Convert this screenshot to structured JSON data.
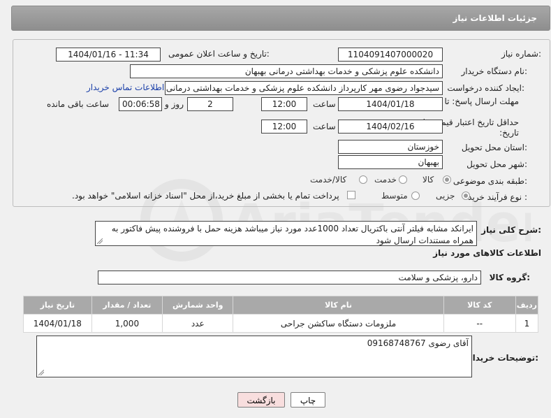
{
  "header": {
    "title": "جزئیات اطلاعات نیاز"
  },
  "form": {
    "need_number_label": "شماره نیاز:",
    "need_number": "1104091407000020",
    "announce_label": "تاریخ و ساعت اعلان عمومی:",
    "announce_value": "1404/01/16 - 11:34",
    "buyer_org_label": "نام دستگاه خریدار:",
    "buyer_org": "دانشکده علوم پزشکی و خدمات بهداشتی  درمانی بهبهان",
    "creator_label": "ایجاد کننده درخواست:",
    "creator": "سیدجواد رضوی مهر کارپرداز دانشکده علوم پزشکی و خدمات بهداشتی  درمانی",
    "buyer_contact_link": "اطلاعات تماس خریدار",
    "reply_deadline_label": "مهلت ارسال پاسخ: تا تاریخ:",
    "reply_date": "1404/01/18",
    "time_label": "ساعت",
    "reply_time": "12:00",
    "days": "2",
    "days_label": "روز و",
    "remaining_time": "00:06:58",
    "remaining_label": "ساعت باقی مانده",
    "price_validity_label": "حداقل تاریخ اعتبار قیمت: تا تاریخ:",
    "validity_date": "1404/02/16",
    "validity_time": "12:00",
    "province_label": "استان محل تحویل:",
    "province": "خوزستان",
    "city_label": "شهر محل تحویل:",
    "city": "بهبهان",
    "category_label": "طبقه بندی موضوعی:",
    "category_options": [
      "کالا",
      "خدمت",
      "کالا/خدمت"
    ],
    "process_label": "نوع فرآیند خرید :",
    "process_options": [
      "جزیی",
      "متوسط"
    ],
    "payment_note": "پرداخت تمام یا بخشی از مبلغ خرید،از محل \"اسناد خزانه اسلامی\" خواهد بود.",
    "description_label": "شرح کلی نیاز:",
    "description": "ایرانکد مشابه فیلتر آنتی باکتریال تعداد 1000عدد مورد نیاز میباشد هزینه حمل با فروشنده پیش فاکتور به همراه مستندات ارسال شود",
    "goods_info_title": "اطلاعات کالاهای مورد نیاز",
    "goods_group_label": "گروه کالا:",
    "goods_group": "دارو، پزشکی و سلامت"
  },
  "table": {
    "headers": [
      "ردیف",
      "کد کالا",
      "نام کالا",
      "واحد شمارش",
      "تعداد / مقدار",
      "تاریخ نیاز"
    ],
    "rows": [
      [
        "1",
        "--",
        "ملزومات دستگاه ساکشن جراحی",
        "عدد",
        "1,000",
        "1404/01/18"
      ]
    ]
  },
  "buyer_notes_label": "توضیحات خریدار:",
  "buyer_notes": "آقای رضوی 09168748767",
  "buttons": {
    "print": "چاپ",
    "back": "بازگشت"
  },
  "colors": {
    "header_bg": "#999999",
    "table_header_bg": "#a9a9a9",
    "back_button_bg": "#f8dede",
    "link": "#1a3fa8"
  }
}
